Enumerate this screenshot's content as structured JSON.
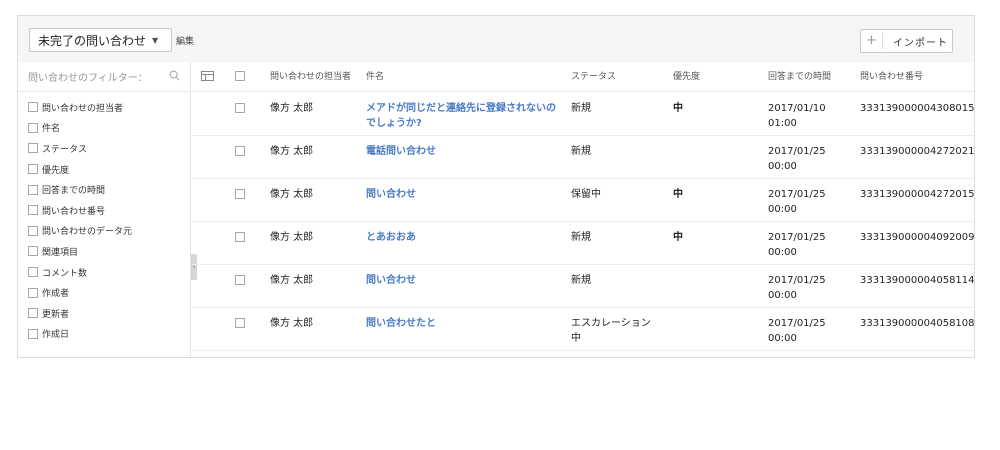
{
  "toolbar": {
    "view_label": "未完了の問い合わせ",
    "edit_label": "編集",
    "import_plus": "+",
    "import_label": "インポート"
  },
  "sidebar": {
    "filter_placeholder": "問い合わせのフィルター：",
    "items": [
      {
        "label": "問い合わせの担当者"
      },
      {
        "label": "件名"
      },
      {
        "label": "ステータス"
      },
      {
        "label": "優先度"
      },
      {
        "label": "回答までの時間"
      },
      {
        "label": "問い合わせ番号"
      },
      {
        "label": "問い合わせのデータ元"
      },
      {
        "label": "関連項目"
      },
      {
        "label": "コメント数"
      },
      {
        "label": "作成者"
      },
      {
        "label": "更新者"
      },
      {
        "label": "作成日"
      }
    ]
  },
  "table": {
    "headers": {
      "owner": "問い合わせの担当者",
      "subject": "件名",
      "status": "ステータス",
      "priority": "優先度",
      "response_time": "回答までの時間",
      "number": "問い合わせ番号"
    },
    "rows": [
      {
        "owner": "像方 太郎",
        "subject": "メアドが同じだと連絡先に登録されないのでしょうか?",
        "status": "新規",
        "priority": "中",
        "time": "2017/01/10 01:00",
        "number": "333139000004308015"
      },
      {
        "owner": "像方 太郎",
        "subject": "電話問い合わせ",
        "status": "新規",
        "priority": "",
        "time": "2017/01/25 00:00",
        "number": "333139000004272021"
      },
      {
        "owner": "像方 太郎",
        "subject": "問い合わせ",
        "status": "保留中",
        "priority": "中",
        "time": "2017/01/25 00:00",
        "number": "333139000004272015"
      },
      {
        "owner": "像方 太郎",
        "subject": "とあおおあ",
        "status": "新規",
        "priority": "中",
        "time": "2017/01/25 00:00",
        "number": "333139000004092009"
      },
      {
        "owner": "像方 太郎",
        "subject": "問い合わせ",
        "status": "新規",
        "priority": "",
        "time": "2017/01/25 00:00",
        "number": "333139000004058114"
      },
      {
        "owner": "像方 太郎",
        "subject": "問い合わせたと",
        "status": "エスカレーション中",
        "priority": "",
        "time": "2017/01/25 00:00",
        "number": "333139000004058108"
      }
    ]
  }
}
